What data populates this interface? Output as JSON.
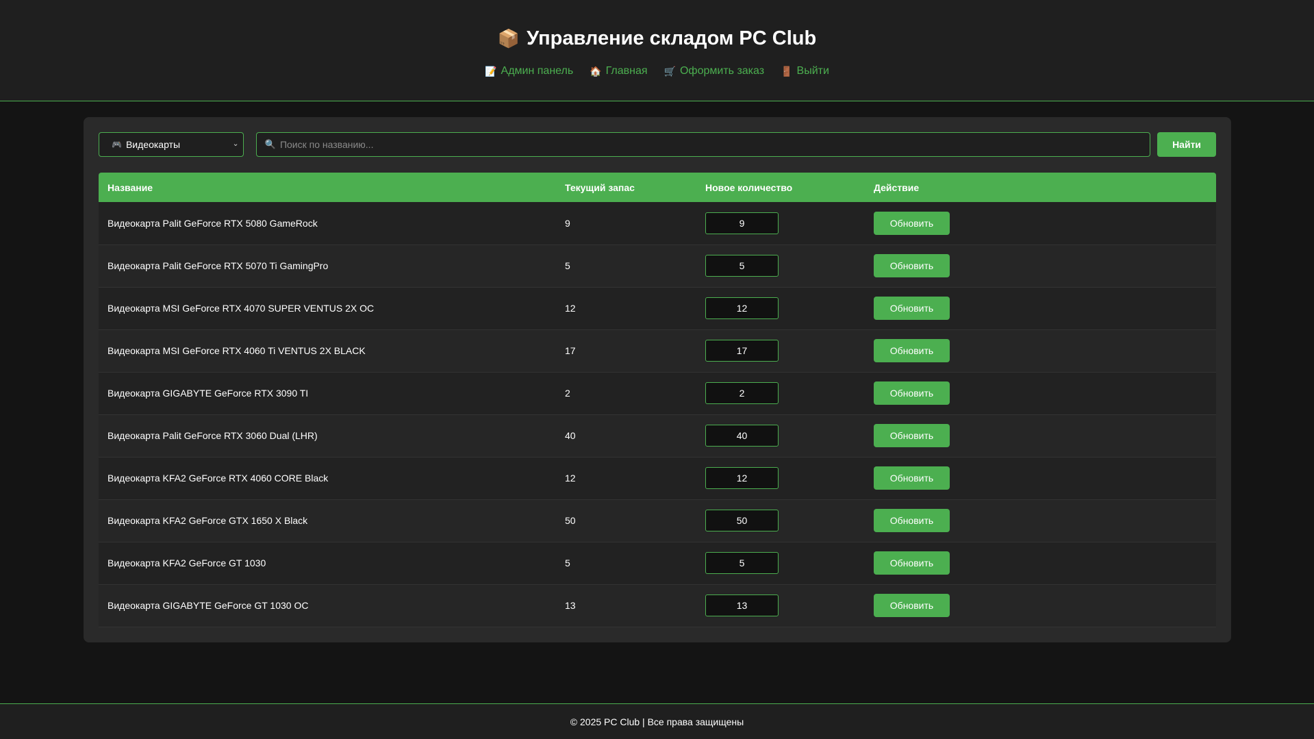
{
  "header": {
    "title_icon": "package-icon",
    "title": "Управление складом PC Club",
    "nav": [
      {
        "icon": "memo-icon",
        "glyph": "📝",
        "label": "Админ панель"
      },
      {
        "icon": "house-icon",
        "glyph": "🏠",
        "label": "Главная"
      },
      {
        "icon": "cart-icon",
        "glyph": "🛒",
        "label": "Оформить заказ"
      },
      {
        "icon": "door-icon",
        "glyph": "🚪",
        "label": "Выйти"
      }
    ]
  },
  "filters": {
    "category_icon": "gamepad-icon",
    "category_selected": "Видеокарты",
    "search_icon": "magnifier-icon",
    "search_placeholder": "Поиск по названию...",
    "search_value": "",
    "find_label": "Найти"
  },
  "table": {
    "columns": [
      "Название",
      "Текущий запас",
      "Новое количество",
      "Действие"
    ],
    "rows": [
      {
        "name": "Видеокарта Palit GeForce RTX 5080 GameRock",
        "stock": "9",
        "new_qty": "9",
        "action": "Обновить"
      },
      {
        "name": "Видеокарта Palit GeForce RTX 5070 Ti GamingPro",
        "stock": "5",
        "new_qty": "5",
        "action": "Обновить"
      },
      {
        "name": "Видеокарта MSI GeForce RTX 4070 SUPER VENTUS 2X OC",
        "stock": "12",
        "new_qty": "12",
        "action": "Обновить"
      },
      {
        "name": "Видеокарта MSI GeForce RTX 4060 Ti VENTUS 2X BLACK",
        "stock": "17",
        "new_qty": "17",
        "action": "Обновить"
      },
      {
        "name": "Видеокарта GIGABYTE GeForce RTX 3090 TI",
        "stock": "2",
        "new_qty": "2",
        "action": "Обновить"
      },
      {
        "name": "Видеокарта Palit GeForce RTX 3060 Dual (LHR)",
        "stock": "40",
        "new_qty": "40",
        "action": "Обновить"
      },
      {
        "name": "Видеокарта KFA2 GeForce RTX 4060 CORE Black",
        "stock": "12",
        "new_qty": "12",
        "action": "Обновить"
      },
      {
        "name": "Видеокарта KFA2 GeForce GTX 1650 X Black",
        "stock": "50",
        "new_qty": "50",
        "action": "Обновить"
      },
      {
        "name": "Видеокарта KFA2 GeForce GT 1030",
        "stock": "5",
        "new_qty": "5",
        "action": "Обновить"
      },
      {
        "name": "Видеокарта GIGABYTE GeForce GT 1030 OC",
        "stock": "13",
        "new_qty": "13",
        "action": "Обновить"
      }
    ]
  },
  "footer": {
    "text": "© 2025 PC Club | Все права защищены"
  },
  "colors": {
    "accent": "#4caf50",
    "background": "#141414",
    "panel": "#2a2a2a",
    "header_bg": "#1f1f1f"
  }
}
